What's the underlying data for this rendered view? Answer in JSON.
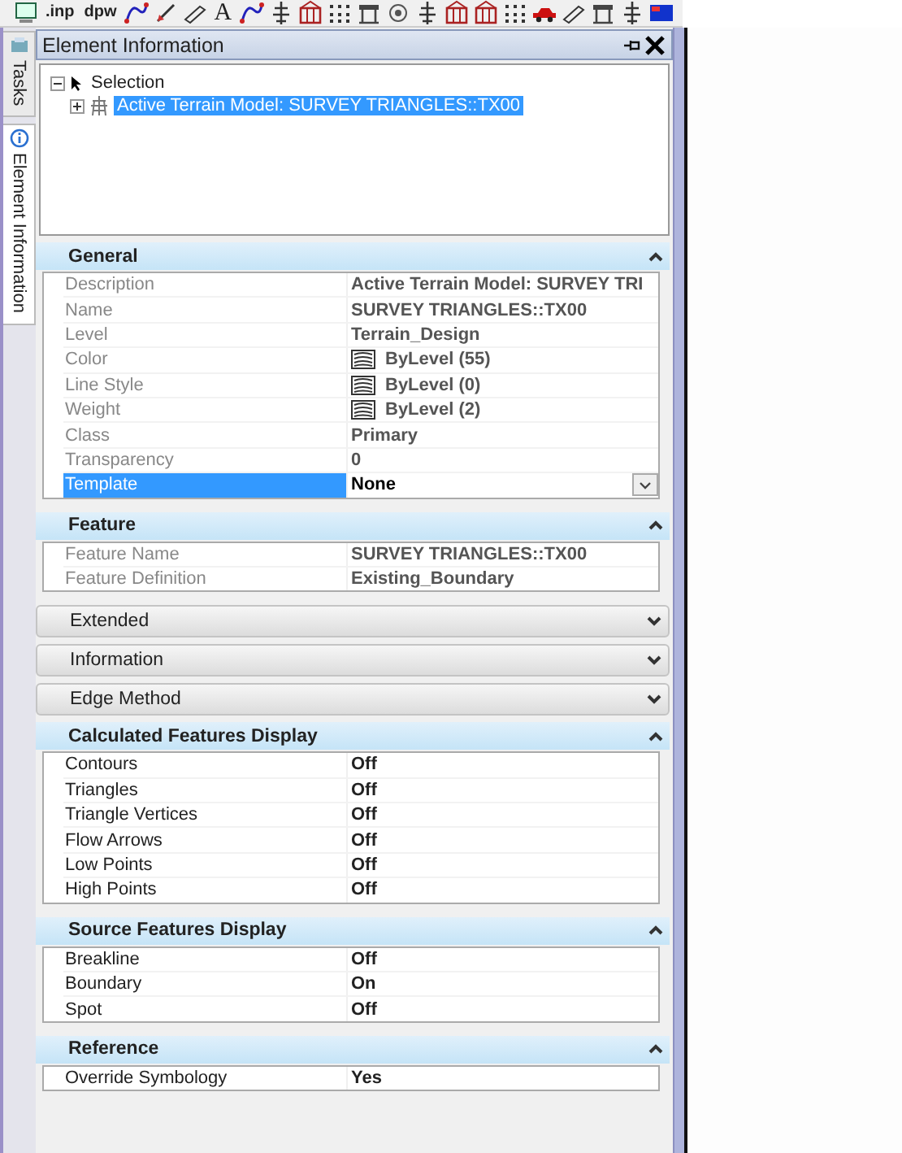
{
  "toolbar": [
    {
      "kind": "screen"
    },
    {
      "kind": "text",
      "label": ".inp"
    },
    {
      "kind": "text",
      "label": "dpw"
    },
    {
      "kind": "curve"
    },
    {
      "kind": "pen"
    },
    {
      "kind": "pencil"
    },
    {
      "kind": "text",
      "label": "A"
    },
    {
      "kind": "curve"
    },
    {
      "kind": "tower"
    },
    {
      "kind": "building"
    },
    {
      "kind": "grid"
    },
    {
      "kind": "table"
    },
    {
      "kind": "target"
    },
    {
      "kind": "tower"
    },
    {
      "kind": "building"
    },
    {
      "kind": "building"
    },
    {
      "kind": "grid"
    },
    {
      "kind": "car"
    },
    {
      "kind": "pencil"
    },
    {
      "kind": "table"
    },
    {
      "kind": "tower"
    },
    {
      "kind": "flag"
    }
  ],
  "side_tabs": [
    {
      "label": "Tasks",
      "selected": false
    },
    {
      "label": "Element Information",
      "selected": true
    }
  ],
  "panel": {
    "title": "Element Information",
    "tree": [
      {
        "label": "Selection",
        "expanded": true,
        "selected": false,
        "children": [
          {
            "label": "Active Terrain Model: SURVEY TRIANGLES::TX00",
            "expanded": false,
            "selected": true
          }
        ]
      }
    ],
    "sections": [
      {
        "title": "General",
        "expanded": true,
        "read_only": true,
        "rows": [
          {
            "label": "Description",
            "value": "Active Terrain Model: SURVEY TRI",
            "kind": "text",
            "selected": false
          },
          {
            "label": "Name",
            "value": "SURVEY TRIANGLES::TX00",
            "kind": "text",
            "selected": false
          },
          {
            "label": "Level",
            "value": "Terrain_Design",
            "kind": "text",
            "selected": false
          },
          {
            "label": "Color",
            "value": "ByLevel (55)",
            "kind": "symbology",
            "selected": false
          },
          {
            "label": "Line Style",
            "value": "ByLevel (0)",
            "kind": "symbology",
            "selected": false
          },
          {
            "label": "Weight",
            "value": "ByLevel (2)",
            "kind": "symbology",
            "selected": false
          },
          {
            "label": "Class",
            "value": "Primary",
            "kind": "text",
            "selected": false
          },
          {
            "label": "Transparency",
            "value": "0",
            "kind": "text",
            "selected": false
          },
          {
            "label": "Template",
            "value": "None",
            "kind": "dropdown",
            "selected": true
          }
        ]
      },
      {
        "title": "Feature",
        "expanded": true,
        "read_only": true,
        "rows": [
          {
            "label": "Feature Name",
            "value": "SURVEY TRIANGLES::TX00",
            "kind": "text",
            "selected": false
          },
          {
            "label": "Feature Definition",
            "value": "Existing_Boundary",
            "kind": "text",
            "selected": false
          }
        ]
      },
      {
        "title": "Extended",
        "expanded": false
      },
      {
        "title": "Information",
        "expanded": false
      },
      {
        "title": "Edge Method",
        "expanded": false
      },
      {
        "title": "Calculated Features Display",
        "expanded": true,
        "read_only": false,
        "rows": [
          {
            "label": "Contours",
            "value": "Off",
            "kind": "text",
            "selected": false
          },
          {
            "label": "Triangles",
            "value": "Off",
            "kind": "text",
            "selected": false
          },
          {
            "label": "Triangle Vertices",
            "value": "Off",
            "kind": "text",
            "selected": false
          },
          {
            "label": "Flow Arrows",
            "value": "Off",
            "kind": "text",
            "selected": false
          },
          {
            "label": "Low Points",
            "value": "Off",
            "kind": "text",
            "selected": false
          },
          {
            "label": "High Points",
            "value": "Off",
            "kind": "text",
            "selected": false
          }
        ]
      },
      {
        "title": "Source Features Display",
        "expanded": true,
        "read_only": false,
        "rows": [
          {
            "label": "Breakline",
            "value": "Off",
            "kind": "text",
            "selected": false
          },
          {
            "label": "Boundary",
            "value": "On",
            "kind": "text",
            "selected": false
          },
          {
            "label": "Spot",
            "value": "Off",
            "kind": "text",
            "selected": false
          }
        ]
      },
      {
        "title": "Reference",
        "expanded": true,
        "read_only": false,
        "rows": [
          {
            "label": "Override Symbology",
            "value": "Yes",
            "kind": "text",
            "selected": false
          }
        ]
      }
    ]
  }
}
